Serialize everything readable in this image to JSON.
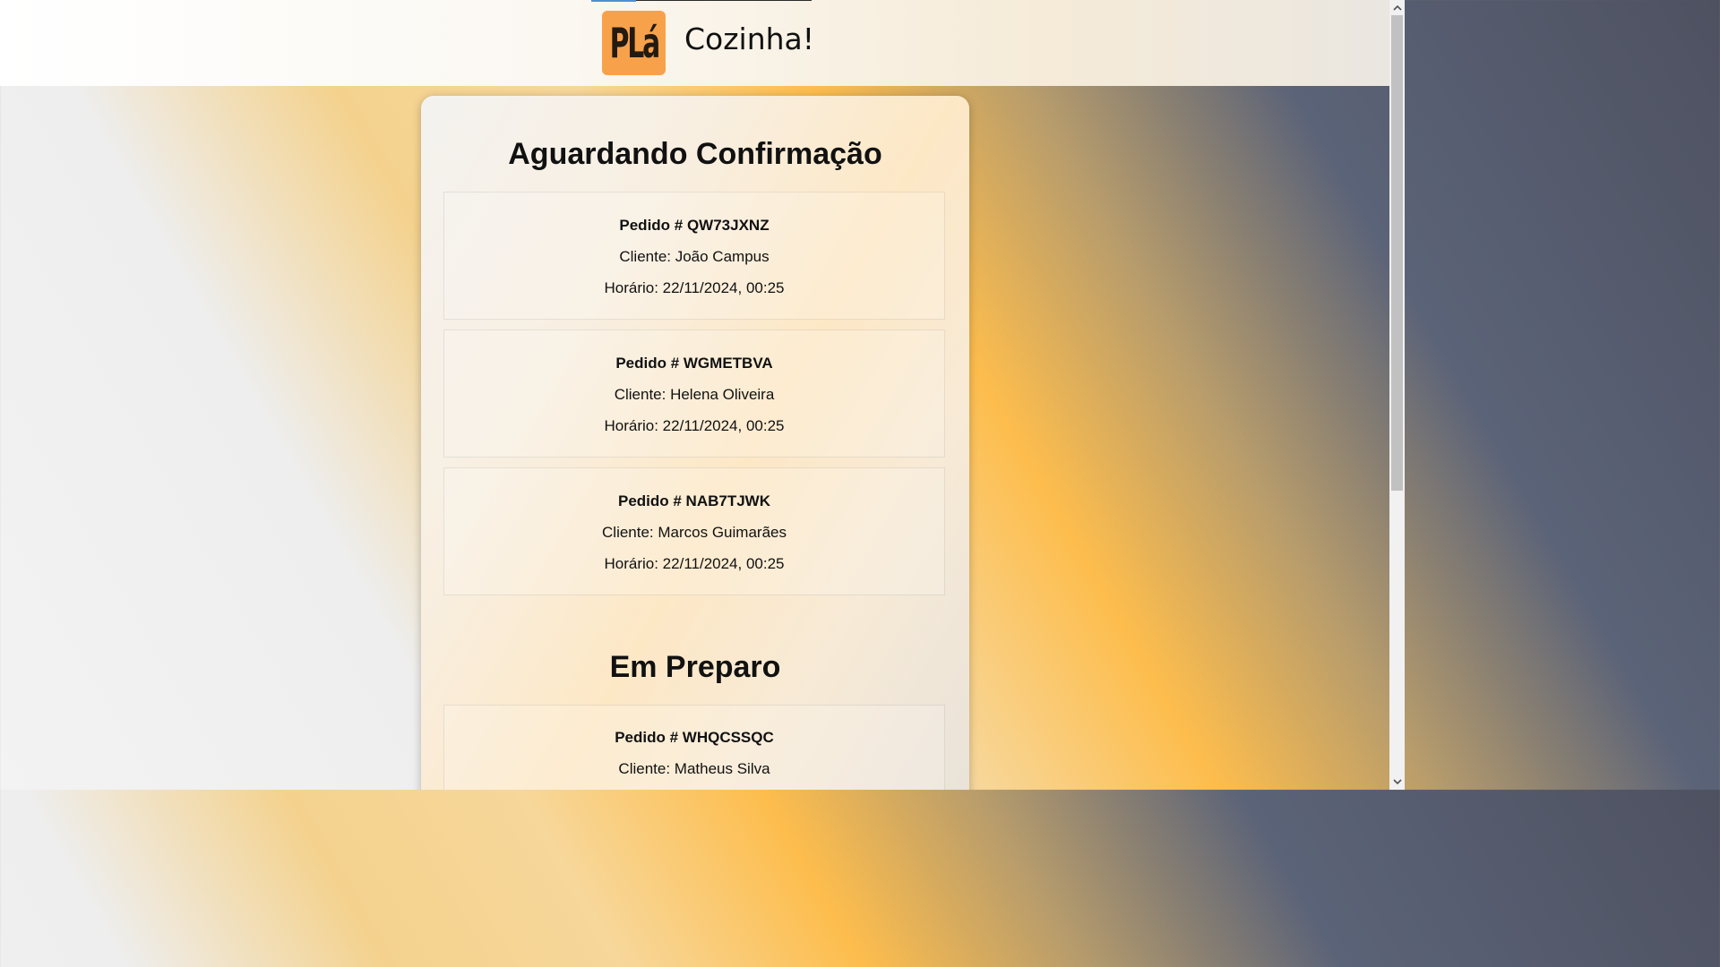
{
  "header": {
    "logo_text": "PLá",
    "brand": "Cozinha!"
  },
  "sections": [
    {
      "title": "Aguardando Confirmação",
      "orders": [
        {
          "id": "Pedido # QW73JXNZ",
          "client": "Cliente: João Campus",
          "time": "Horário: 22/11/2024, 00:25"
        },
        {
          "id": "Pedido # WGMETBVA",
          "client": "Cliente: Helena Oliveira",
          "time": "Horário: 22/11/2024, 00:25"
        },
        {
          "id": "Pedido # NAB7TJWK",
          "client": "Cliente: Marcos Guimarães",
          "time": "Horário: 22/11/2024, 00:25"
        }
      ]
    },
    {
      "title": "Em Preparo",
      "orders": [
        {
          "id": "Pedido # WHQCSSQC",
          "client": "Cliente: Matheus Silva",
          "time": ""
        }
      ]
    }
  ],
  "icons": {
    "scroll_up": "chevron-up-icon",
    "scroll_down": "chevron-down-icon"
  },
  "colors": {
    "logo_bg": "#f7a24a",
    "accent": "#fdbd4d"
  }
}
